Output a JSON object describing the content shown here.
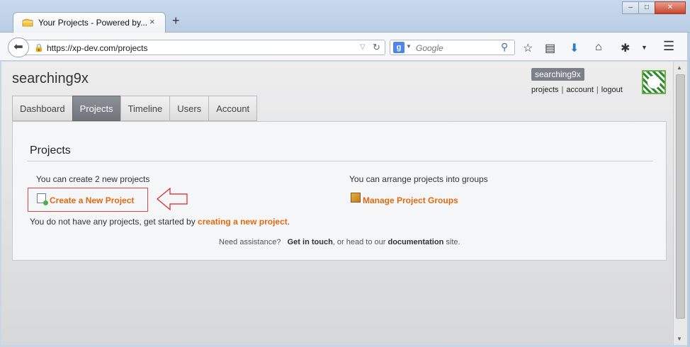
{
  "browser": {
    "tab_title": "Your Projects - Powered by...",
    "tab_close": "×",
    "new_tab": "+",
    "url": "https://xp-dev.com/projects",
    "search_placeholder": "Google",
    "window_buttons": {
      "minimize": "–",
      "maximize": "□",
      "close": "✕"
    }
  },
  "site": {
    "title": "searching9x",
    "user": {
      "name": "searching9x",
      "links": [
        "projects",
        "account",
        "logout"
      ],
      "separators": "|"
    }
  },
  "nav": {
    "tabs": [
      {
        "label": "Dashboard",
        "active": false
      },
      {
        "label": "Projects",
        "active": true
      },
      {
        "label": "Timeline",
        "active": false
      },
      {
        "label": "Users",
        "active": false
      },
      {
        "label": "Account",
        "active": false
      }
    ]
  },
  "panel": {
    "title": "Projects",
    "create_info": "You can create 2 new projects",
    "create_link": "Create a New Project",
    "groups_info": "You can arrange projects into groups",
    "groups_link": "Manage Project Groups",
    "no_projects_prefix": "You do not have any projects, get started by ",
    "no_projects_link": "creating a new project",
    "no_projects_suffix": ".",
    "assist_prefix": "Need assistance?",
    "assist_contact": "Get in touch",
    "assist_middle": ", or head to our",
    "assist_docs": "documentation",
    "assist_suffix": "site."
  },
  "colors": {
    "link_orange": "#e06a10",
    "active_tab": "#7b8089",
    "highlight_box": "#dd4444"
  },
  "icons": {
    "back": "back-arrow-icon",
    "lock": "lock-icon",
    "reload": "reload-icon",
    "search": "magnifier-icon",
    "bookmark_star": "star-icon",
    "reading_list": "reading-list-icon",
    "downloads": "download-icon",
    "home": "home-icon",
    "extension": "bug-extension-icon",
    "menu": "hamburger-menu-icon",
    "create": "new-project-icon",
    "groups": "project-groups-icon",
    "annotation_arrow": "left-arrow-outline-icon"
  }
}
